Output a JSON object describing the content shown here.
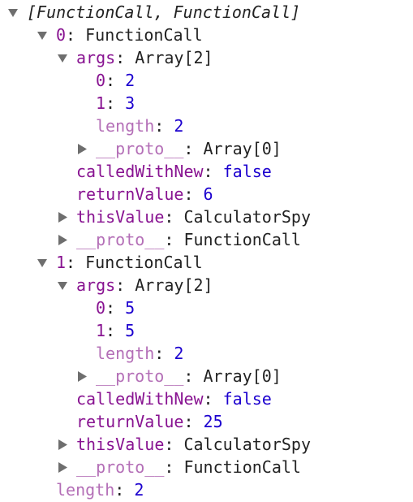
{
  "colors": {
    "key": "#881391",
    "key_dim": "#b46fb7",
    "primitive": "#1c00cf",
    "text": "#222222",
    "triangle": "#6e6e6e"
  },
  "rows": [
    {
      "depth": 0,
      "toggle": "expanded",
      "summary": "[FunctionCall, FunctionCall]"
    },
    {
      "depth": 1,
      "toggle": "expanded",
      "key": "0",
      "value": "FunctionCall",
      "vtype": "obj"
    },
    {
      "depth": 2,
      "toggle": "expanded",
      "key": "args",
      "value": "Array[2]",
      "vtype": "obj"
    },
    {
      "depth": 3,
      "toggle": "none",
      "key": "0",
      "value": "2",
      "vtype": "num"
    },
    {
      "depth": 3,
      "toggle": "none",
      "key": "1",
      "value": "3",
      "vtype": "num"
    },
    {
      "depth": 3,
      "toggle": "none",
      "key": "length",
      "value": "2",
      "vtype": "num",
      "dim": true
    },
    {
      "depth": 3,
      "toggle": "collapsed",
      "key": "__proto__",
      "value": "Array[0]",
      "vtype": "obj",
      "dim": true
    },
    {
      "depth": 2,
      "toggle": "none",
      "key": "calledWithNew",
      "value": "false",
      "vtype": "bool"
    },
    {
      "depth": 2,
      "toggle": "none",
      "key": "returnValue",
      "value": "6",
      "vtype": "num"
    },
    {
      "depth": 2,
      "toggle": "collapsed",
      "key": "thisValue",
      "value": "CalculatorSpy",
      "vtype": "obj"
    },
    {
      "depth": 2,
      "toggle": "collapsed",
      "key": "__proto__",
      "value": "FunctionCall",
      "vtype": "obj",
      "dim": true
    },
    {
      "depth": 1,
      "toggle": "expanded",
      "key": "1",
      "value": "FunctionCall",
      "vtype": "obj"
    },
    {
      "depth": 2,
      "toggle": "expanded",
      "key": "args",
      "value": "Array[2]",
      "vtype": "obj"
    },
    {
      "depth": 3,
      "toggle": "none",
      "key": "0",
      "value": "5",
      "vtype": "num"
    },
    {
      "depth": 3,
      "toggle": "none",
      "key": "1",
      "value": "5",
      "vtype": "num"
    },
    {
      "depth": 3,
      "toggle": "none",
      "key": "length",
      "value": "2",
      "vtype": "num",
      "dim": true
    },
    {
      "depth": 3,
      "toggle": "collapsed",
      "key": "__proto__",
      "value": "Array[0]",
      "vtype": "obj",
      "dim": true
    },
    {
      "depth": 2,
      "toggle": "none",
      "key": "calledWithNew",
      "value": "false",
      "vtype": "bool"
    },
    {
      "depth": 2,
      "toggle": "none",
      "key": "returnValue",
      "value": "25",
      "vtype": "num"
    },
    {
      "depth": 2,
      "toggle": "collapsed",
      "key": "thisValue",
      "value": "CalculatorSpy",
      "vtype": "obj"
    },
    {
      "depth": 2,
      "toggle": "collapsed",
      "key": "__proto__",
      "value": "FunctionCall",
      "vtype": "obj",
      "dim": true
    },
    {
      "depth": 1,
      "toggle": "none",
      "key": "length",
      "value": "2",
      "vtype": "num",
      "dim": true
    }
  ]
}
